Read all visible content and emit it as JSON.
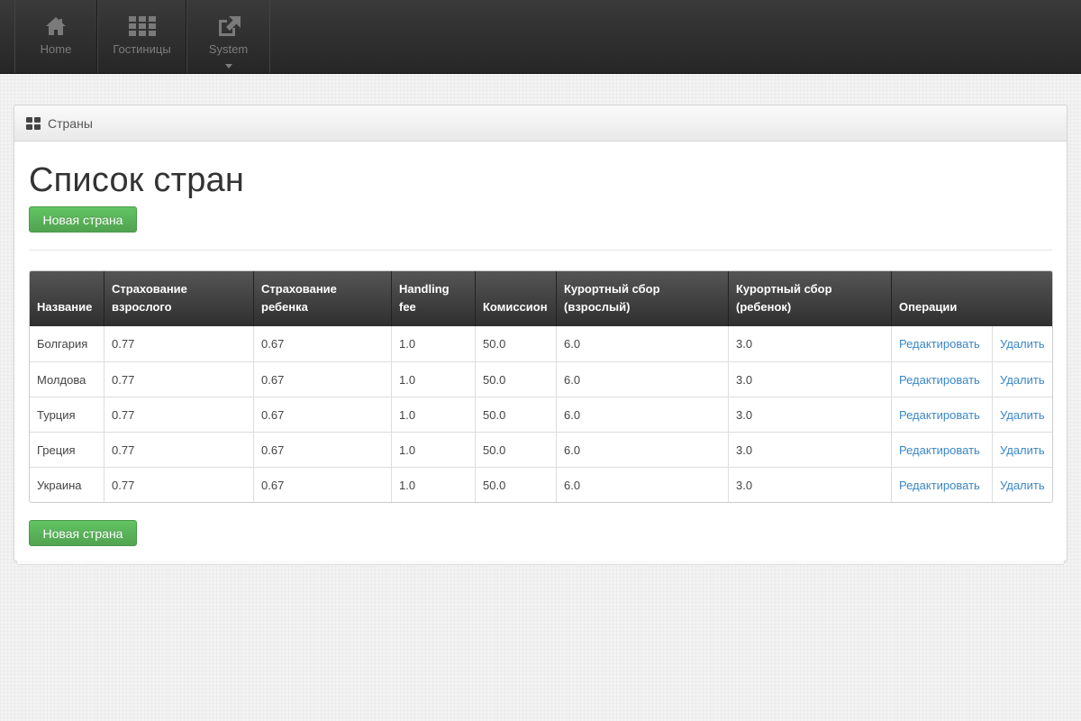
{
  "nav": {
    "items": [
      {
        "label": "Home",
        "icon": "home-icon"
      },
      {
        "label": "Гостиницы",
        "icon": "grid-icon"
      },
      {
        "label": "System",
        "icon": "external-link-icon"
      }
    ]
  },
  "panel": {
    "header": "Страны",
    "header_icon": "dashboard-icon"
  },
  "page": {
    "title": "Список стран",
    "new_button": "Новая страна",
    "new_button_bottom": "Новая страна"
  },
  "table": {
    "headers": [
      "Название",
      "Страхование взрослого",
      "Страхование ребенка",
      "Handling fee",
      "Комиссион",
      "Курортный сбор (взрослый)",
      "Курортный сбор (ребенок)",
      "Операции"
    ],
    "rows": [
      {
        "name": "Болгария",
        "adult_ins": "0.77",
        "child_ins": "0.67",
        "handling": "1.0",
        "commission": "50.0",
        "resort_adult": "6.0",
        "resort_child": "3.0",
        "edit": "Редактировать",
        "delete": "Удалить"
      },
      {
        "name": "Молдова",
        "adult_ins": "0.77",
        "child_ins": "0.67",
        "handling": "1.0",
        "commission": "50.0",
        "resort_adult": "6.0",
        "resort_child": "3.0",
        "edit": "Редактировать",
        "delete": "Удалить"
      },
      {
        "name": "Турция",
        "adult_ins": "0.77",
        "child_ins": "0.67",
        "handling": "1.0",
        "commission": "50.0",
        "resort_adult": "6.0",
        "resort_child": "3.0",
        "edit": "Редактировать",
        "delete": "Удалить"
      },
      {
        "name": "Греция",
        "adult_ins": "0.77",
        "child_ins": "0.67",
        "handling": "1.0",
        "commission": "50.0",
        "resort_adult": "6.0",
        "resort_child": "3.0",
        "edit": "Редактировать",
        "delete": "Удалить"
      },
      {
        "name": "Украина",
        "adult_ins": "0.77",
        "child_ins": "0.67",
        "handling": "1.0",
        "commission": "50.0",
        "resort_adult": "6.0",
        "resort_child": "3.0",
        "edit": "Редактировать",
        "delete": "Удалить"
      }
    ]
  },
  "colors": {
    "accent_green": "#5bb75b",
    "link_blue": "#3a87c8",
    "navbar_dark": "#2e2e2e"
  }
}
